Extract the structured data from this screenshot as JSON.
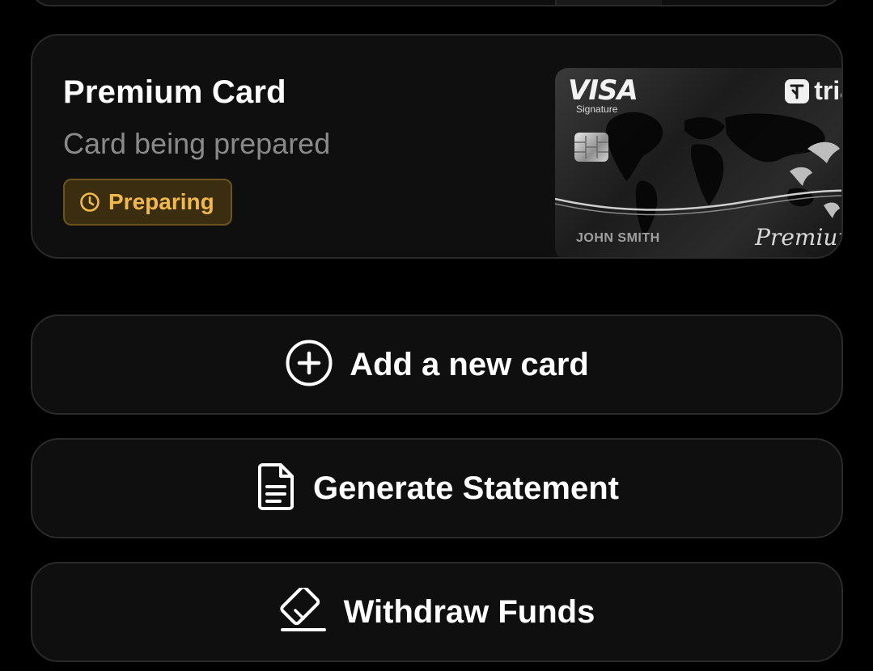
{
  "card": {
    "title": "Premium Card",
    "subtitle": "Card being prepared",
    "status": {
      "label": "Preparing",
      "icon": "clock-icon",
      "color": "#f2b84b",
      "background": "#3a2d10"
    },
    "art": {
      "network": "VISA",
      "network_tier": "Signature",
      "brand": "tria",
      "holder_name": "JOHN SMITH",
      "tier_script": "Premium"
    }
  },
  "actions": [
    {
      "label": "Add a new card",
      "icon": "plus-circle-icon"
    },
    {
      "label": "Generate Statement",
      "icon": "document-icon"
    },
    {
      "label": "Withdraw Funds",
      "icon": "card-withdraw-icon"
    }
  ]
}
